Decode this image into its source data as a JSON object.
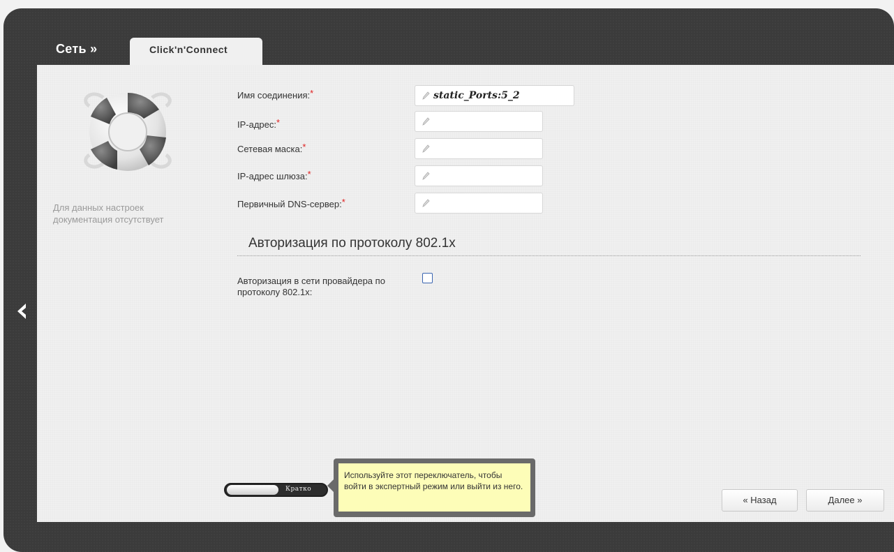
{
  "header": {
    "title": "Сеть »",
    "tab_label": "Click'n'Connect"
  },
  "sidebar": {
    "help_text": "Для данных настроек документация отсутствует"
  },
  "form": {
    "connection_name_label": "Имя соединения:",
    "connection_name_value": "static_Ports:5_2",
    "ip_label": "IP-адрес:",
    "ip_value": "",
    "netmask_label": "Сетевая маска:",
    "netmask_value": "",
    "gateway_label": "IP-адрес шлюза:",
    "gateway_value": "",
    "dns_label": "Первичный DNS-сервер:",
    "dns_value": "",
    "required_mark": "*"
  },
  "auth_section": {
    "title": "Авторизация по протоколу 802.1x",
    "checkbox_label": "Авторизация в сети провайдера по протоколу 802.1x:",
    "checkbox_checked": false
  },
  "footer": {
    "toggle_label": "Кратко",
    "tooltip_text": "Используйте этот переключатель, чтобы войти в экспертный режим или выйти из него.",
    "back_button": "« Назад",
    "next_button": "Далее »"
  },
  "colors": {
    "frame": "#3b3b3b",
    "panel": "#f0f0f0",
    "required": "#e02020",
    "tooltip_bg": "#fdfdb8",
    "checkbox_border": "#3a64b0"
  },
  "icons": {
    "back": "chevron-left-icon",
    "help_image": "lifebuoy-icon",
    "field": "pencil-icon"
  }
}
